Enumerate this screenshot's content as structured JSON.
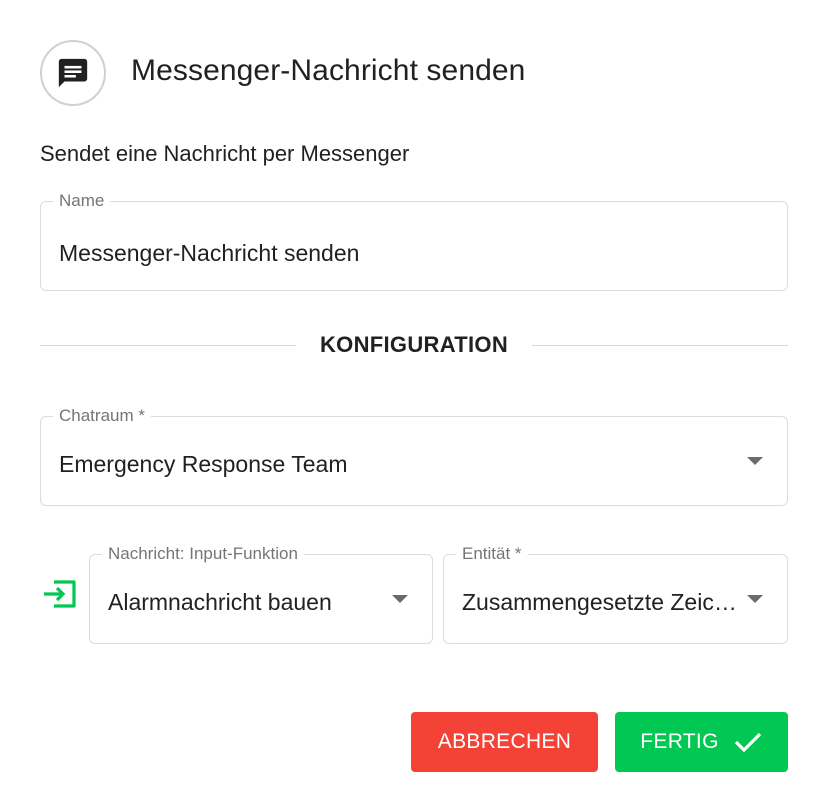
{
  "dialog": {
    "title": "Messenger-Nachricht senden",
    "subtitle": "Sendet eine Nachricht per Messenger",
    "header_icon": "message-icon"
  },
  "name_field": {
    "label": "Name",
    "value": "Messenger-Nachricht senden"
  },
  "section": {
    "title": "KONFIGURATION"
  },
  "chatroom_field": {
    "label": "Chatraum *",
    "value": "Emergency Response Team"
  },
  "message_field": {
    "label": "Nachricht: Input-Funktion",
    "value": "Alarmnachricht bauen",
    "icon": "input-icon"
  },
  "entity_field": {
    "label": "Entität *",
    "value": "Zusammengesetzte Zeichenkette"
  },
  "buttons": {
    "cancel": "ABBRECHEN",
    "done": "FERTIG"
  },
  "colors": {
    "cancel": "#f44336",
    "done": "#00c853",
    "input_icon": "#00c853"
  }
}
